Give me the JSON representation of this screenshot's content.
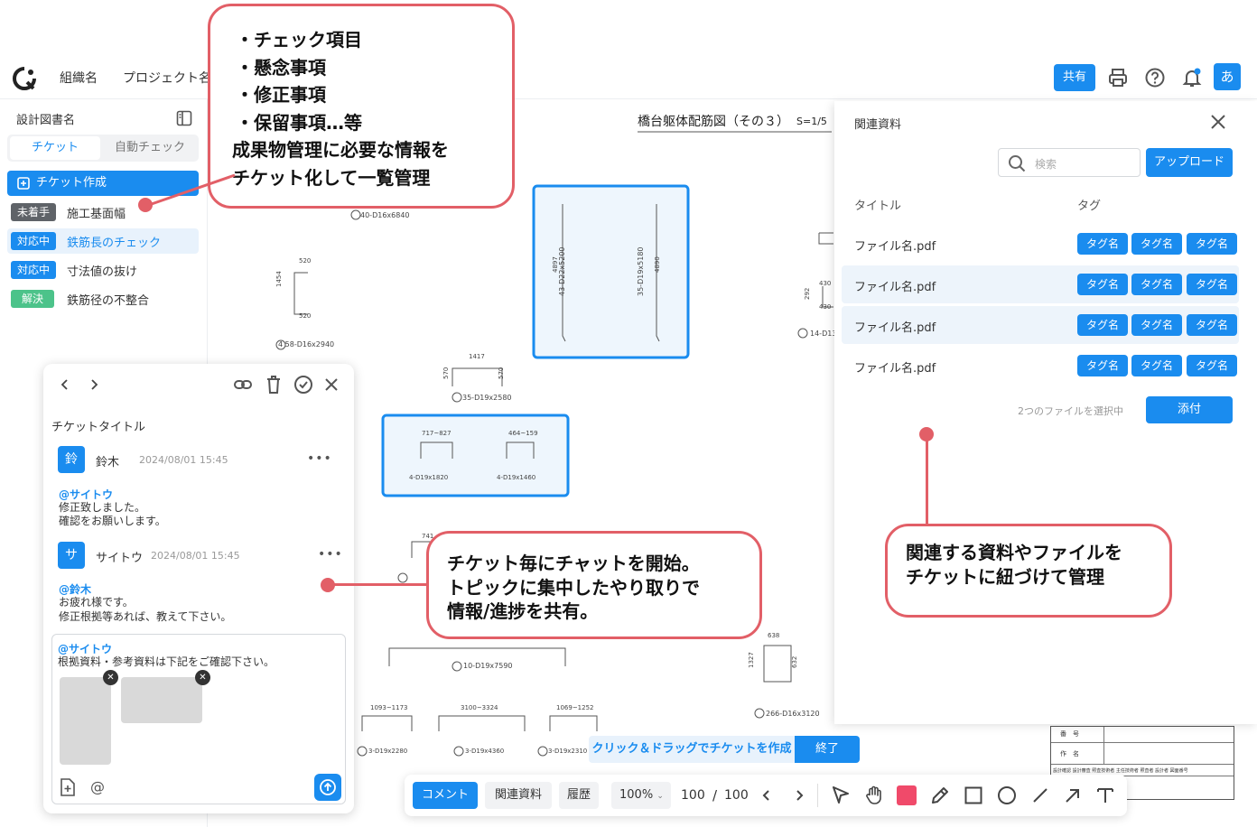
{
  "header": {
    "org": "組織名",
    "project": "プロジェクト名",
    "share_label": "共有",
    "user_initial": "あ"
  },
  "sidebar": {
    "doc_title": "設計図書名",
    "tabs": [
      "チケット",
      "自動チェック"
    ],
    "create_label": "チケット作成",
    "tickets": [
      {
        "status": "未着手",
        "status_color": "#5f6368",
        "label": "施工基面幅"
      },
      {
        "status": "対応中",
        "status_color": "#1a8cef",
        "label": "鉄筋長のチェック"
      },
      {
        "status": "対応中",
        "status_color": "#1a8cef",
        "label": "寸法値の抜け"
      },
      {
        "status": "解決",
        "status_color": "#4cc38a",
        "label": "鉄筋径の不整合"
      }
    ]
  },
  "drawing": {
    "title": "橋台躯体配筋図（その３）",
    "scale": "S=1/5",
    "labels": [
      "40-D16x6840",
      "4 58-D16x2940",
      "35-D19x2580",
      "43-D22x5200",
      "35-D19x5180",
      "14-D13",
      "4-D19x1820",
      "4-D19x1460",
      "10-D19x7590",
      "266-D16x3120",
      "3-D19x2280",
      "3-D19x4360",
      "3-D19x2310"
    ],
    "dims": [
      "520",
      "1454",
      "520",
      "1417",
      "570",
      "570",
      "717~827",
      "464~159",
      "4897",
      "4890",
      "3100~3324",
      "1093~1173",
      "1069~1252",
      "638",
      "1327",
      "632",
      "430",
      "292",
      "430",
      "741"
    ]
  },
  "callouts": {
    "top": [
      "・チェック項目",
      "・懸念事項",
      "・修正事項",
      "・保留事項…等",
      "成果物管理に必要な情報を",
      "チケット化して一覧管理"
    ],
    "middle": [
      "チケット毎にチャットを開始。",
      "トピックに集中したやり取りで",
      "情報/進捗を共有。"
    ],
    "right": [
      "関連する資料やファイルを",
      "チケットに紐づけて管理"
    ]
  },
  "chat": {
    "title": "チケットタイトル",
    "messages": [
      {
        "avatar": "鈴",
        "name": "鈴木",
        "time": "2024/08/01 15:45",
        "mention": "@サイトウ",
        "lines": [
          "修正致しました。",
          "確認をお願いします。"
        ]
      },
      {
        "avatar": "サ",
        "name": "サイトウ",
        "time": "2024/08/01 15:45",
        "mention": "@鈴木",
        "lines": [
          "お疲れ様です。",
          "修正根拠等あれば、教えて下さい。"
        ]
      }
    ],
    "draft_mention": "@サイトウ",
    "draft_text": "根拠資料・参考資料は下記をご確認下さい。"
  },
  "docs": {
    "title": "関連資料",
    "search_placeholder": "検索",
    "upload_label": "アップロード",
    "col_title": "タイトル",
    "col_tag": "タグ",
    "files": [
      {
        "name": "ファイル名.pdf",
        "tags": [
          "タグ名",
          "タグ名",
          "タグ名"
        ],
        "selected": false
      },
      {
        "name": "ファイル名.pdf",
        "tags": [
          "タグ名",
          "タグ名",
          "タグ名"
        ],
        "selected": true
      },
      {
        "name": "ファイル名.pdf",
        "tags": [
          "タグ名",
          "タグ名",
          "タグ名"
        ],
        "selected": true
      },
      {
        "name": "ファイル名.pdf",
        "tags": [
          "タグ名",
          "タグ名",
          "タグ名"
        ],
        "selected": false
      }
    ],
    "selection_text": "2つのファイルを選択中",
    "attach_label": "添付"
  },
  "drag_banner": {
    "text": "クリック＆ドラッグでチケットを作成",
    "done_label": "終了"
  },
  "toolbar": {
    "comment": "コメント",
    "related": "関連資料",
    "history": "履歴",
    "zoom": "100%",
    "page": "100",
    "separator": "/",
    "total": "100"
  },
  "titleblock": {
    "r1": "番　号",
    "r2": "作　名",
    "r3": [
      "設計確認",
      "設計審査",
      "照査技術者",
      "主任技術者",
      "照査者",
      "設計者",
      "図面番号"
    ]
  },
  "colors": {
    "accent": "#1a8cef",
    "callout": "#e25f67",
    "selected_row": "#edf4fb",
    "highlight": "#e8f2fc"
  }
}
